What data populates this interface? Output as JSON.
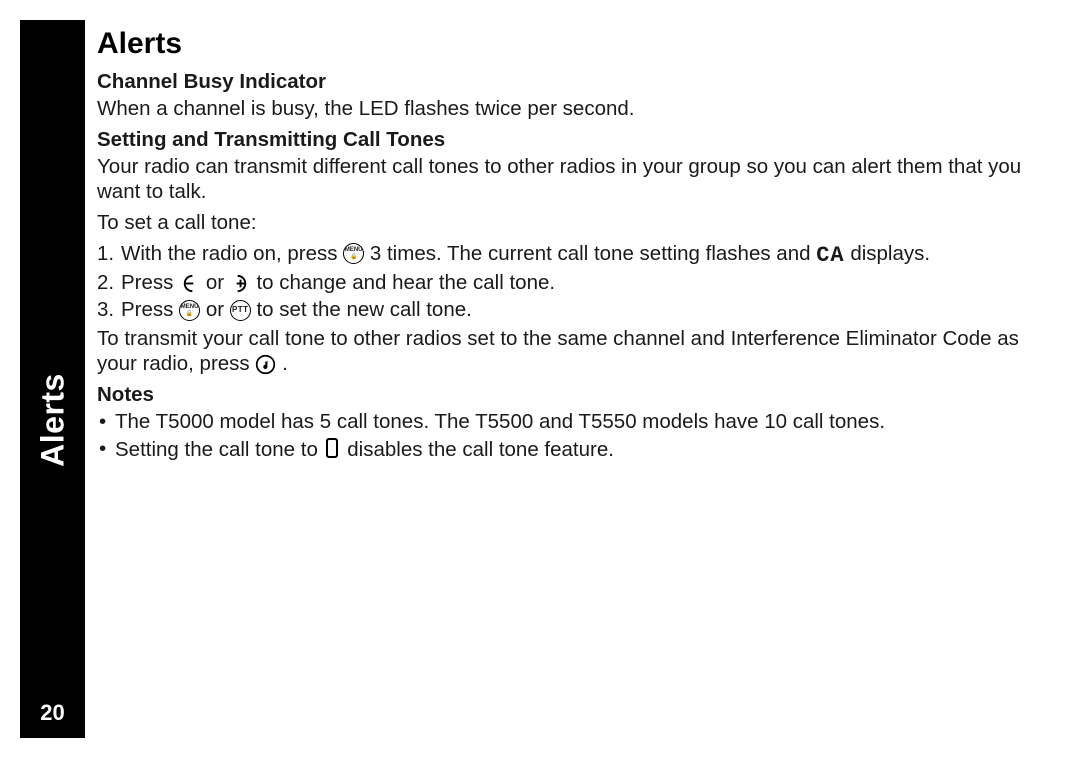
{
  "sidebar": {
    "label": "Alerts",
    "page_number": "20"
  },
  "content": {
    "title": "Alerts",
    "s1_head": "Channel Busy Indicator",
    "s1_body": "When a channel is busy, the LED flashes twice per second.",
    "s2_head": "Setting and Transmitting Call Tones",
    "s2_body": "Your radio can transmit different call tones to other radios in your group so you can alert them that you want to talk.",
    "s2_lead": "To set a call tone:",
    "step1_a": "With the radio on, press ",
    "step1_b": " 3 times. The current call tone setting flashes and ",
    "step1_c": " displays.",
    "step2_a": "Press ",
    "step2_b": " or ",
    "step2_c": " to change and hear the call tone.",
    "step3_a": "Press ",
    "step3_b": " or ",
    "step3_c": " to set the new call tone.",
    "transmit_a": "To transmit your call tone to other radios set to the same channel and Interference Eliminator Code as your radio, press ",
    "transmit_b": ".",
    "notes_head": "Notes",
    "note1": "The T5000 model has 5 call tones. The T5500 and T5550 models have 10 call tones.",
    "note2_a": "Setting the call tone to ",
    "note2_b": " disables the call tone feature.",
    "icons": {
      "menu": "MENU",
      "ptt": "PTT",
      "ca_glyph": "CA"
    }
  }
}
